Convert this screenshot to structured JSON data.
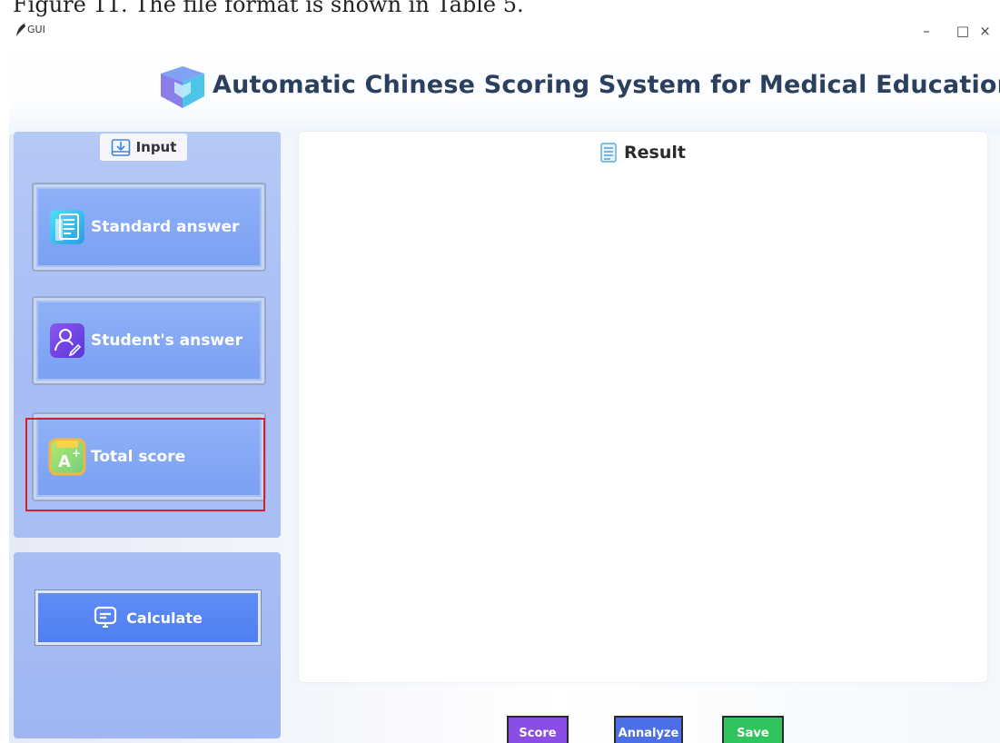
{
  "caption": "Figure 11. The file format is shown in Table 5.",
  "window": {
    "title": "GUI",
    "minimize_glyph": "–",
    "maximize_glyph": "□",
    "close_glyph": "×"
  },
  "header": {
    "title": "Automatic Chinese Scoring System for Medical Education",
    "logo_icon": "cube-logo-icon"
  },
  "input_panel": {
    "tab_label": "Input",
    "buttons": [
      {
        "label": "Standard answer",
        "icon": "document-list-icon"
      },
      {
        "label": "Student's answer",
        "icon": "student-edit-icon"
      },
      {
        "label": "Total score",
        "icon": "grade-a-plus-icon"
      }
    ],
    "highlighted": "Total score",
    "highlight_color": "#d4202c"
  },
  "calculate": {
    "label": "Calculate",
    "icon": "monitor-icon"
  },
  "result": {
    "title": "Result",
    "icon": "result-doc-icon"
  },
  "actions": [
    {
      "label": "Score",
      "color": "#8a4ee6"
    },
    {
      "label": "Annalyze",
      "color": "#4c6fe8"
    },
    {
      "label": "Save",
      "color": "#2fc45e"
    }
  ]
}
